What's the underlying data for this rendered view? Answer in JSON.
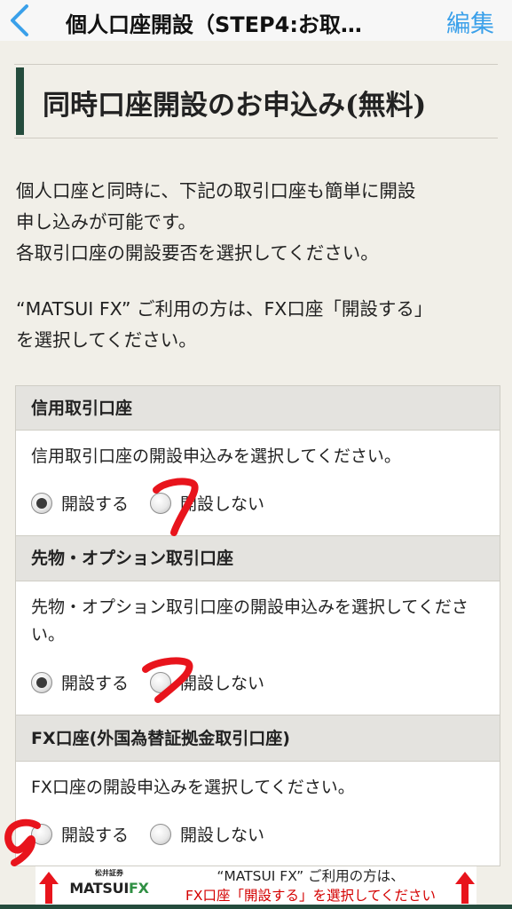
{
  "navbar": {
    "title": "個人口座開設（STEP4:お取…",
    "edit_label": "編集"
  },
  "heading": {
    "text": "同時口座開設のお申込み(無料)"
  },
  "intro": {
    "lines": [
      "個人口座と同時に、下記の取引口座も簡単に開設",
      "申し込みが可能です。",
      "各取引口座の開設要否を選択してください。"
    ],
    "matsui_lines": [
      "“MATSUI FX” ご利用の方は、FX口座「開設する」",
      "を選択してください。"
    ]
  },
  "sections": [
    {
      "title": "信用取引口座",
      "desc": "信用取引口座の開設申込みを選択してください。",
      "options": [
        "開設する",
        "開設しない"
      ],
      "selected": 0
    },
    {
      "title": "先物・オプション取引口座",
      "desc": "先物・オプション取引口座の開設申込みを選択してください。",
      "options": [
        "開設する",
        "開設しない"
      ],
      "selected": 0
    },
    {
      "title": "FX口座(外国為替証拠金取引口座)",
      "desc": "FX口座の開設申込みを選択してください。",
      "options": [
        "開設する",
        "開設しない"
      ],
      "selected": null
    }
  ],
  "banner": {
    "logo_small": "松井証券",
    "logo_main_a": "MATSUI",
    "logo_main_b": "FX",
    "line1": "“MATSUI FX” ご利用の方は、",
    "line2": "FX口座「開設する」を選択してください"
  },
  "colors": {
    "accent_blue": "#3aa0ea",
    "heading_bar": "#254c3d",
    "annotation_red": "#e8141c",
    "banner_red": "#d40000"
  }
}
